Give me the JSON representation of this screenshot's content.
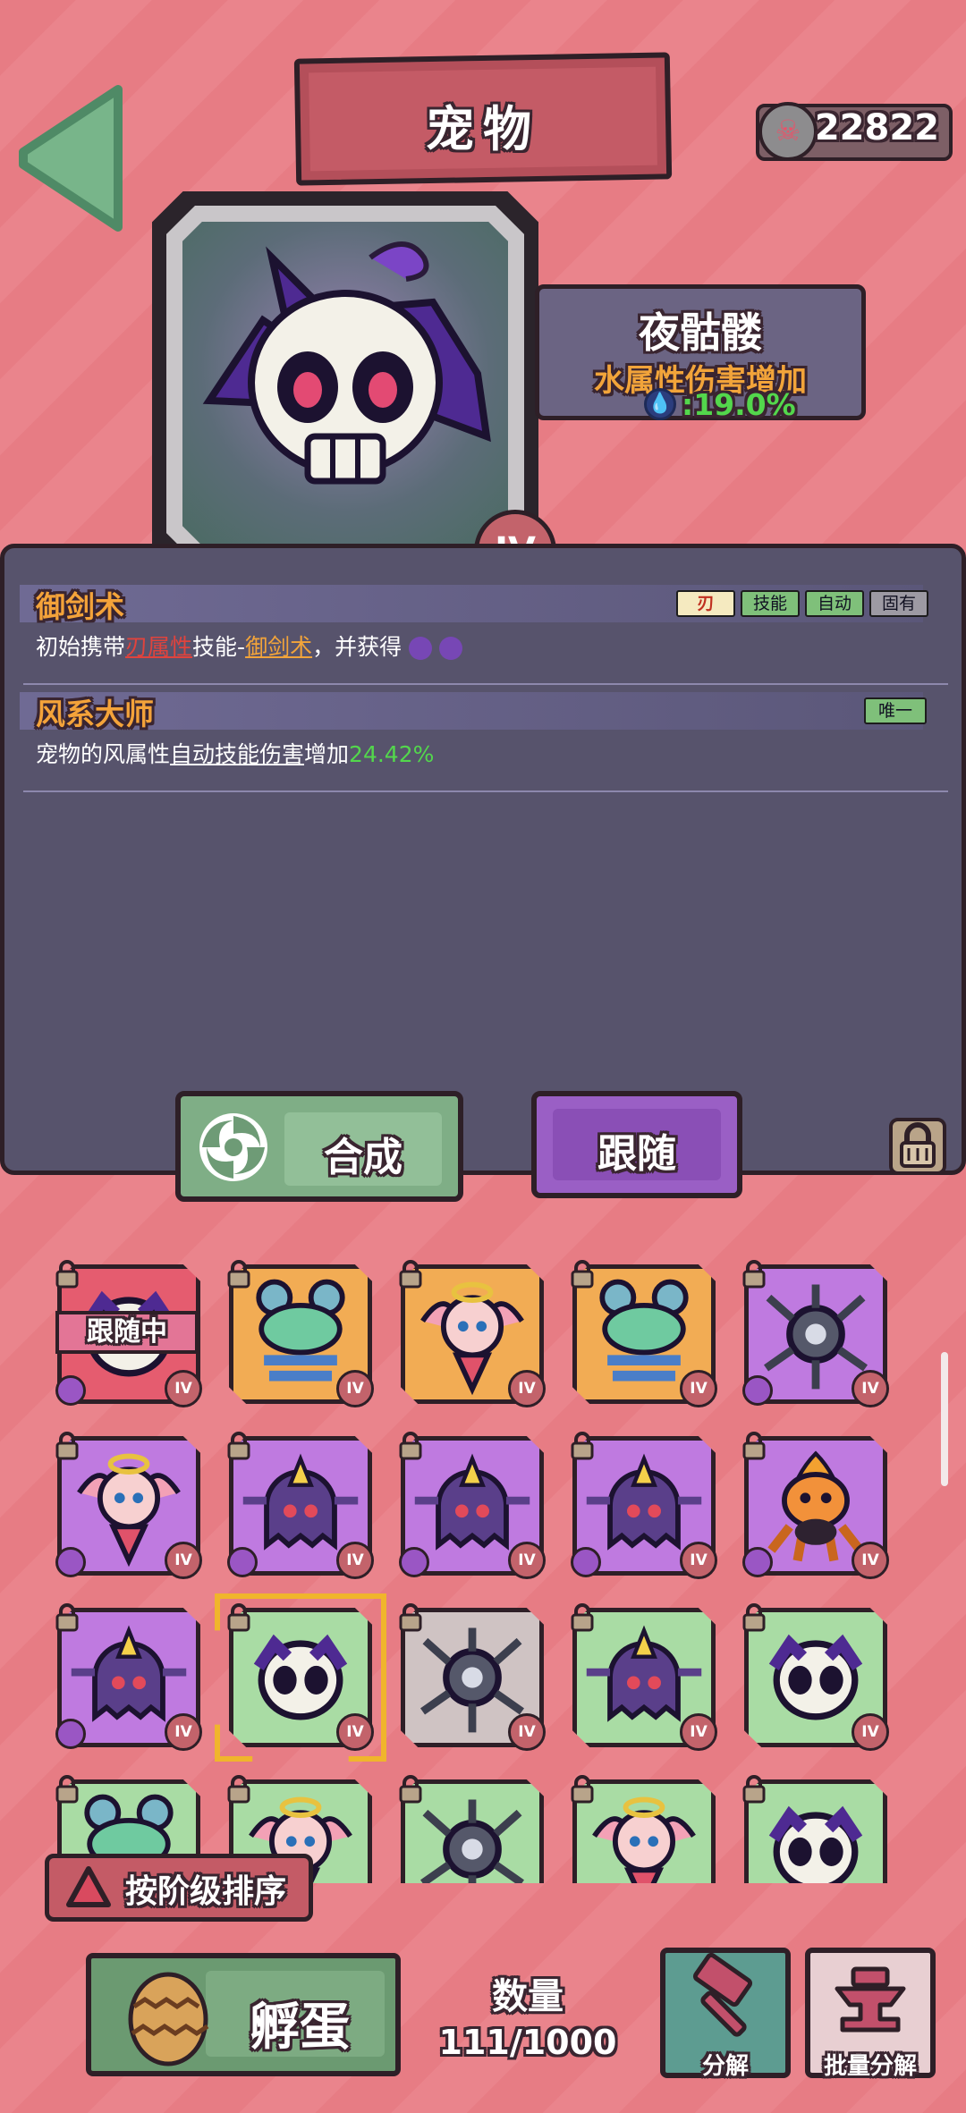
{
  "header": {
    "title": "宠物",
    "coin_icon": "skull-coin-icon",
    "coins": "22822"
  },
  "pet": {
    "name": "夜骷髅",
    "attribute": "水属性伤害增加",
    "attribute_icon": "water-drop-icon",
    "attribute_value": ":19.0%",
    "tier": "IV"
  },
  "skills": [
    {
      "title": "御剑术",
      "tags": [
        "刃",
        "技能",
        "自动",
        "固有"
      ],
      "desc_parts": [
        "初始携带",
        "刃属性",
        "技能-",
        "御剑术",
        "，并获得"
      ]
    },
    {
      "title": "风系大师",
      "tags": [
        "唯一"
      ],
      "desc_parts": [
        "宠物的风属性",
        "自动技能伤害",
        "增加",
        "24.42%"
      ]
    }
  ],
  "buttons": {
    "merge": "合成",
    "follow": "跟随",
    "sort": "按阶级排序",
    "hatch": "孵蛋",
    "decompose": "分解",
    "batch_decompose": "批量分解"
  },
  "grid": {
    "following_label": "跟随中",
    "tier": "IV",
    "cells": [
      {
        "color": "red",
        "pet": "skull",
        "following": true
      },
      {
        "color": "orange",
        "pet": "spinner"
      },
      {
        "color": "orange",
        "pet": "fairy"
      },
      {
        "color": "orange",
        "pet": "spinner"
      },
      {
        "color": "purple",
        "pet": "spider"
      },
      {
        "color": "purple",
        "pet": "fairy"
      },
      {
        "color": "purple",
        "pet": "ghost"
      },
      {
        "color": "purple",
        "pet": "ghost"
      },
      {
        "color": "purple",
        "pet": "ghost"
      },
      {
        "color": "purple",
        "pet": "pumpkin"
      },
      {
        "color": "purple",
        "pet": "ghost"
      },
      {
        "color": "green",
        "pet": "skull",
        "selected": true
      },
      {
        "color": "gray",
        "pet": "spider"
      },
      {
        "color": "green",
        "pet": "ghost"
      },
      {
        "color": "green",
        "pet": "skull"
      },
      {
        "color": "green",
        "pet": "spinner"
      },
      {
        "color": "green",
        "pet": "fairy"
      },
      {
        "color": "green",
        "pet": "spider"
      },
      {
        "color": "green",
        "pet": "fairy"
      },
      {
        "color": "green",
        "pet": "skull"
      }
    ]
  },
  "count": {
    "label": "数量",
    "value": "111/1000"
  }
}
